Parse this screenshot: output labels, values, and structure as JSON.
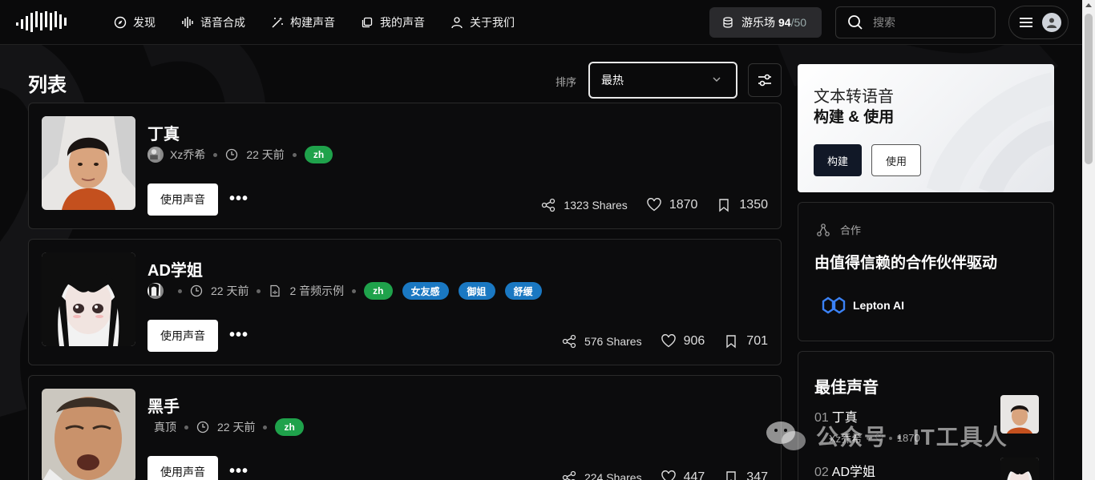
{
  "nav": {
    "items": [
      {
        "label": "发现",
        "icon": "compass-icon"
      },
      {
        "label": "语音合成",
        "icon": "waveform-icon"
      },
      {
        "label": "构建声音",
        "icon": "magic-wand-icon"
      },
      {
        "label": "我的声音",
        "icon": "stack-icon"
      },
      {
        "label": "关于我们",
        "icon": "user-icon"
      }
    ],
    "playground_label": "游乐场",
    "quota_used": "94",
    "quota_sep_max": "/50",
    "search_placeholder": "搜索"
  },
  "main": {
    "title": "列表",
    "sort_label": "排序",
    "sort_value": "最热",
    "voices": [
      {
        "name": "丁真",
        "author": "Xz乔希",
        "time": "22 天前",
        "samples": "",
        "tags": [
          {
            "text": "zh",
            "kind": "lang"
          }
        ],
        "use_label": "使用声音",
        "shares": "1323 Shares",
        "likes": "1870",
        "saves": "1350"
      },
      {
        "name": "AD学姐",
        "author": "",
        "time": "22 天前",
        "samples": "2 音频示例",
        "tags": [
          {
            "text": "zh",
            "kind": "lang"
          },
          {
            "text": "女友感",
            "kind": "style"
          },
          {
            "text": "御姐",
            "kind": "style"
          },
          {
            "text": "舒缓",
            "kind": "style"
          }
        ],
        "use_label": "使用声音",
        "shares": "576 Shares",
        "likes": "906",
        "saves": "701"
      },
      {
        "name": "黑手",
        "author": "真顶",
        "time": "22 天前",
        "samples": "",
        "tags": [
          {
            "text": "zh",
            "kind": "lang"
          }
        ],
        "use_label": "使用声音",
        "shares": "224 Shares",
        "likes": "447",
        "saves": "347"
      }
    ]
  },
  "sidebar": {
    "tts_title": "文本转语音",
    "tts_subtitle": "构建 & 使用",
    "build_label": "构建",
    "use_label": "使用",
    "partner_label": "合作",
    "partner_heading": "由值得信赖的合作伙伴驱动",
    "partner_name": "Lepton AI",
    "best_heading": "最佳声音",
    "best": [
      {
        "rank": "01",
        "name": "丁真",
        "author": "Xz乔希",
        "likes": "1870"
      },
      {
        "rank": "02",
        "name": "AD学姐",
        "author": "",
        "likes": ""
      }
    ]
  },
  "watermark": "公众号 · IT工具人",
  "colors": {
    "background": "#0a0a0b",
    "lang_tag": "#1fa24b",
    "style_tag": "#1a78c2"
  }
}
